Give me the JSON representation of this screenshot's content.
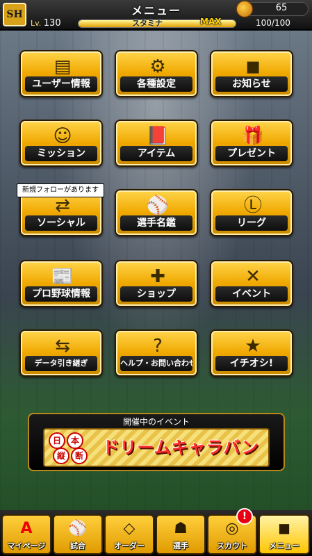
{
  "header": {
    "logo": "SH",
    "title": "メニュー",
    "coins": "65",
    "level_label": "Lv.",
    "level_value": "130",
    "stamina_label": "スタミナ",
    "stamina_max_label": "MAX",
    "stamina_value": "100/100",
    "stamina_fraction": 1.0
  },
  "menu": {
    "row1": [
      "ユーザー情報",
      "各種設定",
      "お知らせ"
    ],
    "row2": [
      "ミッション",
      "アイテム",
      "プレゼント"
    ],
    "row3": [
      "ソーシャル",
      "選手名鑑",
      "リーグ"
    ],
    "row4": [
      "プロ野球情報",
      "ショップ",
      "イベント"
    ],
    "row5": [
      "データ引き継ぎ",
      "ヘルプ・お問い合わせ",
      "イチオシ!"
    ],
    "notice": "新規フォローがあります"
  },
  "event": {
    "title": "開催中のイベント",
    "badge_chars": [
      "日",
      "本",
      "縦",
      "断"
    ],
    "name": "ドリームキャラバン"
  },
  "nav": {
    "items": [
      "マイページ",
      "試合",
      "オーダー",
      "選手",
      "スカウト",
      "メニュー"
    ],
    "alert": "!"
  }
}
